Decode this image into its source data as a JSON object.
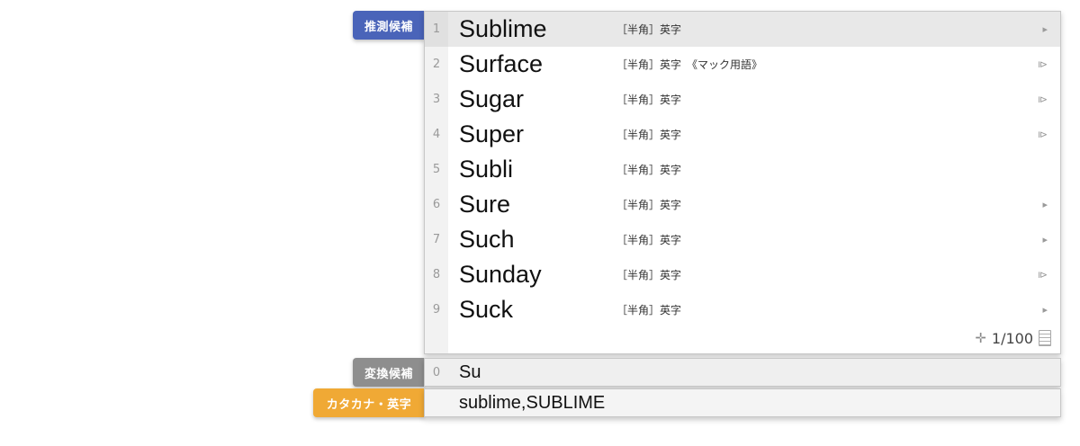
{
  "predictive": {
    "tag_label": "推測候補",
    "candidates": [
      {
        "num": "1",
        "word": "Sublime",
        "info": "［半角］英字",
        "arrow": "▸"
      },
      {
        "num": "2",
        "word": "Surface",
        "info": "［半角］英字　《マック用語》",
        "arrow": "⧐"
      },
      {
        "num": "3",
        "word": "Sugar",
        "info": "［半角］英字",
        "arrow": "⧐"
      },
      {
        "num": "4",
        "word": "Super",
        "info": "［半角］英字",
        "arrow": "⧐"
      },
      {
        "num": "5",
        "word": "Subli",
        "info": "［半角］英字",
        "arrow": ""
      },
      {
        "num": "6",
        "word": "Sure",
        "info": "［半角］英字",
        "arrow": "▸"
      },
      {
        "num": "7",
        "word": "Such",
        "info": "［半角］英字",
        "arrow": "▸"
      },
      {
        "num": "8",
        "word": "Sunday",
        "info": "［半角］英字",
        "arrow": "⧐"
      },
      {
        "num": "9",
        "word": "Suck",
        "info": "［半角］英字",
        "arrow": "▸"
      }
    ],
    "page_indicator": "1/100",
    "plus_glyph": "✛"
  },
  "conversion": {
    "tag_label": "変換候補",
    "num": "0",
    "text": "Su"
  },
  "katakana": {
    "tag_label": "カタカナ・英字",
    "text": "sublime,SUBLIME"
  },
  "colors": {
    "predictive_tag": "#4a64b9",
    "conversion_tag": "#8e8e8e",
    "katakana_tag": "#f0a935"
  }
}
